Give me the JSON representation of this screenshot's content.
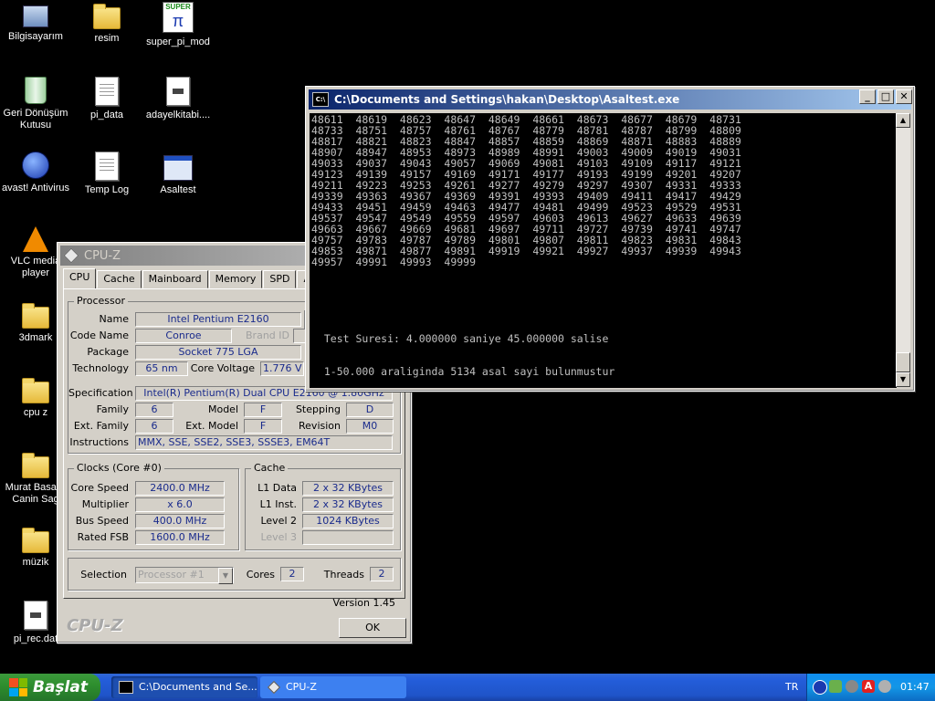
{
  "desktop": {
    "icons": [
      {
        "label": "Bilgisayarım"
      },
      {
        "label": "resim"
      },
      {
        "label": "super_pi_mod",
        "badge": "SUPER",
        "glyph": "π"
      },
      {
        "label": "Geri Dönüşüm Kutusu"
      },
      {
        "label": "pi_data"
      },
      {
        "label": "adayelkitabi...."
      },
      {
        "label": "avast! Antivirus"
      },
      {
        "label": "Temp Log"
      },
      {
        "label": "Asaltest"
      },
      {
        "label": "VLC media player"
      },
      {
        "label": "3dmark"
      },
      {
        "label": "cpu z"
      },
      {
        "label": "Murat Basar - Canin Sag"
      },
      {
        "label": "müzik"
      },
      {
        "label": "pi_rec.dat"
      }
    ]
  },
  "cmd_window": {
    "title": "C:\\Documents and Settings\\hakan\\Desktop\\Asaltest.exe",
    "output_lines": [
      "48611  48619  48623  48647  48649  48661  48673  48677  48679  48731",
      "48733  48751  48757  48761  48767  48779  48781  48787  48799  48809",
      "48817  48821  48823  48847  48857  48859  48869  48871  48883  48889",
      "48907  48947  48953  48973  48989  48991  49003  49009  49019  49031",
      "49033  49037  49043  49057  49069  49081  49103  49109  49117  49121",
      "49123  49139  49157  49169  49171  49177  49193  49199  49201  49207",
      "49211  49223  49253  49261  49277  49279  49297  49307  49331  49333",
      "49339  49363  49367  49369  49391  49393  49409  49411  49417  49429",
      "49433  49451  49459  49463  49477  49481  49499  49523  49529  49531",
      "49537  49547  49549  49559  49597  49603  49613  49627  49633  49639",
      "49663  49667  49669  49681  49697  49711  49727  49739  49741  49747",
      "49757  49783  49787  49789  49801  49807  49811  49823  49831  49843",
      "49853  49871  49877  49891  49919  49921  49927  49937  49939  49943",
      "49957  49991  49993  49999",
      "",
      "",
      "",
      "",
      "",
      "",
      "  Test Suresi: 4.000000 saniye 45.000000 salise",
      "",
      "",
      "  1-50.000 araliginda 5134 asal sayi bulunmustur"
    ]
  },
  "cpuz": {
    "title": "CPU-Z",
    "tabs": [
      "CPU",
      "Cache",
      "Mainboard",
      "Memory",
      "SPD",
      "Abo"
    ],
    "processor": {
      "group_title": "Processor",
      "name_label": "Name",
      "name": "Intel Pentium E2160",
      "codename_label": "Code Name",
      "codename": "Conroe",
      "brandid_label": "Brand ID",
      "package_label": "Package",
      "package": "Socket 775 LGA",
      "technology_label": "Technology",
      "technology": "65 nm",
      "corevoltage_label": "Core Voltage",
      "corevoltage": "1.776 V",
      "spec_label": "Specification",
      "spec": "Intel(R) Pentium(R) Dual  CPU  E2160  @ 1.80GHz",
      "family_label": "Family",
      "family": "6",
      "model_label": "Model",
      "model": "F",
      "stepping_label": "Stepping",
      "stepping": "D",
      "extfamily_label": "Ext. Family",
      "extfamily": "6",
      "extmodel_label": "Ext. Model",
      "extmodel": "F",
      "revision_label": "Revision",
      "revision": "M0",
      "instructions_label": "Instructions",
      "instructions": "MMX, SSE, SSE2, SSE3, SSSE3, EM64T"
    },
    "clocks": {
      "group_title": "Clocks (Core #0)",
      "corespeed_label": "Core Speed",
      "corespeed": "2400.0 MHz",
      "multiplier_label": "Multiplier",
      "multiplier": "x 6.0",
      "busspeed_label": "Bus Speed",
      "busspeed": "400.0 MHz",
      "ratedfsb_label": "Rated FSB",
      "ratedfsb": "1600.0 MHz"
    },
    "cache": {
      "group_title": "Cache",
      "l1data_label": "L1 Data",
      "l1data": "2 x 32 KBytes",
      "l1inst_label": "L1 Inst.",
      "l1inst": "2 x 32 KBytes",
      "level2_label": "Level 2",
      "level2": "1024 KBytes",
      "level3_label": "Level 3"
    },
    "selection": {
      "selection_label": "Selection",
      "selection_value": "Processor #1",
      "cores_label": "Cores",
      "cores": "2",
      "threads_label": "Threads",
      "threads": "2"
    },
    "version": "Version 1.45",
    "brand": "CPU-Z",
    "ok_label": "OK"
  },
  "taskbar": {
    "start_label": "Başlat",
    "tasks": [
      "C:\\Documents and Se...",
      "CPU-Z"
    ],
    "language": "TR",
    "clock": "01:47"
  },
  "colors": {
    "desktop": "#000000",
    "taskbar": "#245edb",
    "start": "#2e8f2e",
    "cpuz_text": "#1a2b8c"
  }
}
